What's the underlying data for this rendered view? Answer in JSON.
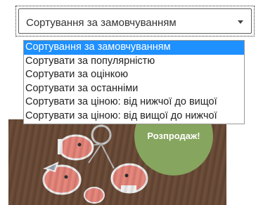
{
  "sort": {
    "selected_label": "Сортування за замовчуванням",
    "options": [
      "Сортування за замовчуванням",
      "Сортувати за популярністю",
      "Сортувати за оцінкою",
      "Сортувати за останніми",
      "Сортувати за ціною: від нижчої до вищої",
      "Сортувати за ціною: від вищої до нижчої"
    ],
    "highlighted_index": 0
  },
  "product": {
    "sale_badge": "Розпродаж!"
  },
  "colors": {
    "highlight": "#1e90ff",
    "sale_badge": "#86a55e"
  },
  "icons": {
    "dropdown_arrow": "caret-down-icon"
  }
}
